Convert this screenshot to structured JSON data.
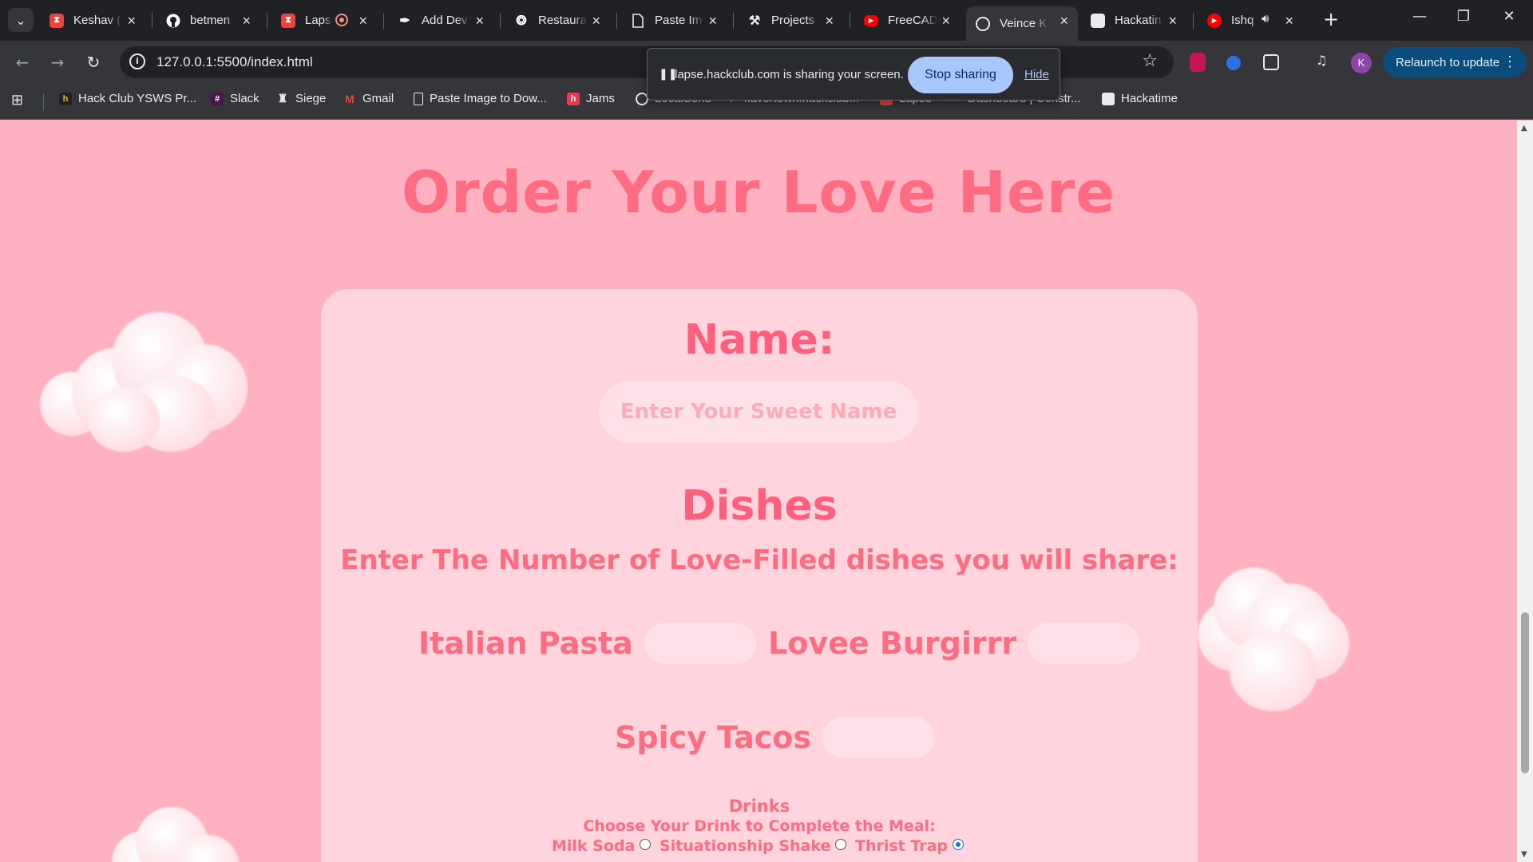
{
  "browser": {
    "tabs": [
      {
        "title": "Keshav (",
        "icon": "lapse-icon",
        "color": "#e8453c"
      },
      {
        "title": "betmen",
        "icon": "github-icon",
        "color": "#ffffff"
      },
      {
        "title": "Laps",
        "icon": "lapse-icon",
        "color": "#e8453c"
      },
      {
        "title": "Add Dev",
        "icon": "quill-icon",
        "color": "#ffffff"
      },
      {
        "title": "Restaura",
        "icon": "openai-icon",
        "color": "#ffffff"
      },
      {
        "title": "Paste Im",
        "icon": "document-icon",
        "color": "#ffffff"
      },
      {
        "title": "Projects",
        "icon": "hammer-icon",
        "color": "#ffffff"
      },
      {
        "title": "FreeCAD",
        "icon": "youtube-icon",
        "color": "#ff0000"
      },
      {
        "title": "Veince K",
        "icon": "globe-icon",
        "color": "#ffffff"
      },
      {
        "title": "Hackatin",
        "icon": "hackatime-icon",
        "color": "#ffffff"
      },
      {
        "title": "Ishq",
        "icon": "youtube-music-icon",
        "color": "#ff0000"
      }
    ],
    "url": "127.0.0.1:5500/index.html",
    "avatar_letter": "K",
    "relaunch_label": "Relaunch to update",
    "bookmarks": [
      "Hack Club YSWS Pr...",
      "Slack",
      "Siege",
      "Gmail",
      "Paste Image to Dow...",
      "Jams",
      "LocalSend",
      "flavortown.hackclub...",
      "Lapse",
      "Dashboard | Constr...",
      "Hackatime"
    ],
    "share_notice": {
      "text": "lapse.hackclub.com is sharing your screen.",
      "stop_label": "Stop sharing",
      "hide_label": "Hide"
    }
  },
  "page": {
    "headline": "Order Your Love Here",
    "name_heading": "Name:",
    "name_placeholder": "Enter Your Sweet Name",
    "dishes_heading": "Dishes",
    "dishes_prompt": "Enter The Number of Love-Filled dishes you will share:",
    "dishes": [
      "Italian Pasta",
      "Lovee Burgirrr",
      "Spicy Tacos"
    ],
    "drinks_heading": "Drinks",
    "drinks_prompt": "Choose Your Drink to Complete the Meal:",
    "drinks": [
      {
        "label": "Milk Soda",
        "selected": false
      },
      {
        "label": "Situationship Shake",
        "selected": false
      },
      {
        "label": "Thrist Trap",
        "selected": true
      }
    ]
  },
  "colors": {
    "page_background": "#ffb1c1",
    "card_background": "#ffd4de",
    "accent_text": "#ff6b81",
    "input_background": "#ffe2e9"
  }
}
